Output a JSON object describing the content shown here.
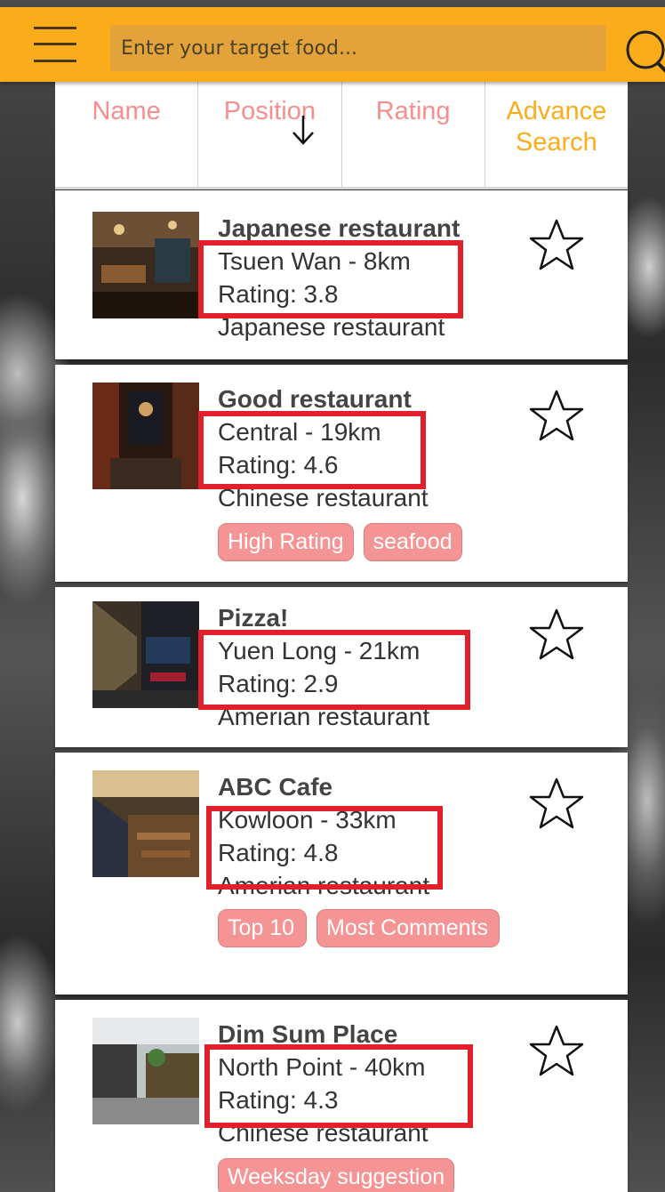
{
  "search": {
    "placeholder": "Enter your target food..."
  },
  "sort": {
    "name_label": "Name",
    "position_label": "Position",
    "rating_label": "Rating",
    "advance_line1": "Advance",
    "advance_line2": "Search"
  },
  "restaurants": [
    {
      "name": "Japanese restaurant",
      "location": "Tsuen Wan - 8km",
      "rating": "Rating: 3.8",
      "type": "Japanese restaurant",
      "tags": []
    },
    {
      "name": "Good restaurant",
      "location": "Central - 19km",
      "rating": "Rating: 4.6",
      "type": "Chinese restaurant",
      "tags": [
        "High Rating",
        "seafood"
      ]
    },
    {
      "name": "Pizza!",
      "location": "Yuen Long - 21km",
      "rating": "Rating: 2.9",
      "type": "Amerian restaurant",
      "tags": []
    },
    {
      "name": "ABC Cafe",
      "location": "Kowloon - 33km",
      "rating": "Rating: 4.8",
      "type": "Amerian restaurant",
      "tags": [
        "Top 10",
        "Most Comments"
      ]
    },
    {
      "name": "Dim Sum Place",
      "location": "North Point - 40km",
      "rating": "Rating: 4.3",
      "type": "Chinese restaurant",
      "tags": [
        "Weeksday suggestion"
      ]
    }
  ],
  "colors": {
    "header": "#fbac1b",
    "sort_text": "#f58f8f",
    "advance_text": "#fbac1b",
    "tag_bg": "#f59494",
    "highlight": "#e0202a"
  }
}
